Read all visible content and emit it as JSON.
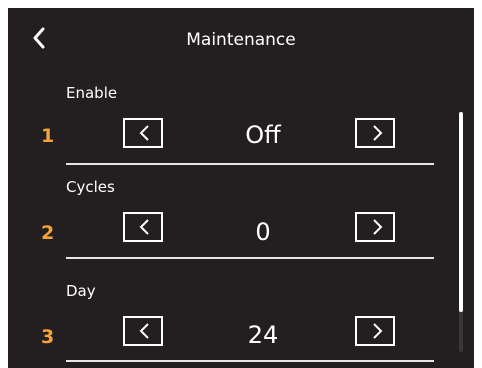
{
  "header": {
    "title": "Maintenance",
    "back_icon": "chevron-left-icon"
  },
  "rows": [
    {
      "number": "1",
      "label": "Enable",
      "value": "Off"
    },
    {
      "number": "2",
      "label": "Cycles",
      "value": "0"
    },
    {
      "number": "3",
      "label": "Day",
      "value": "24"
    }
  ],
  "icons": {
    "decrement": "chevron-left-icon",
    "increment": "chevron-right-icon"
  },
  "colors": {
    "background": "#231f20",
    "accent_number": "#f2a33a",
    "text": "#ffffff"
  }
}
